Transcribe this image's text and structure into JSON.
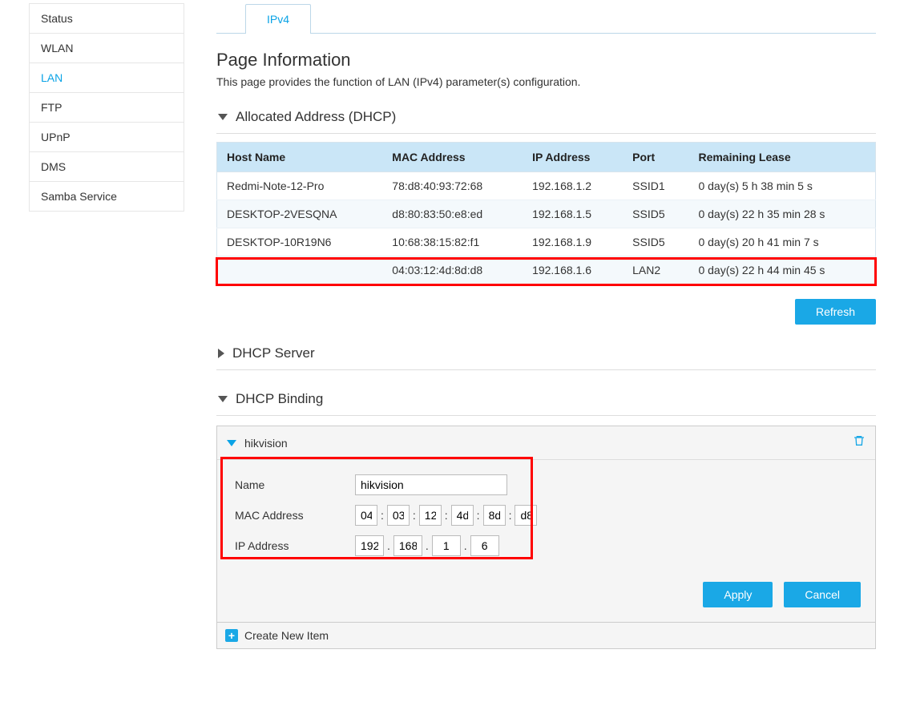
{
  "sidebar": {
    "items": [
      {
        "label": "Status"
      },
      {
        "label": "WLAN"
      },
      {
        "label": "LAN"
      },
      {
        "label": "FTP"
      },
      {
        "label": "UPnP"
      },
      {
        "label": "DMS"
      },
      {
        "label": "Samba Service"
      }
    ],
    "active_index": 2
  },
  "tabs": {
    "active": "IPv4"
  },
  "page": {
    "title": "Page Information",
    "description": "This page provides the function of LAN (IPv4) parameter(s) configuration."
  },
  "sections": {
    "allocated": {
      "title": "Allocated Address (DHCP)",
      "columns": [
        "Host Name",
        "MAC Address",
        "IP Address",
        "Port",
        "Remaining Lease"
      ],
      "rows": [
        {
          "host": "Redmi-Note-12-Pro",
          "mac": "78:d8:40:93:72:68",
          "ip": "192.168.1.2",
          "port": "SSID1",
          "lease": "0 day(s) 5 h 38 min 5 s"
        },
        {
          "host": "DESKTOP-2VESQNA",
          "mac": "d8:80:83:50:e8:ed",
          "ip": "192.168.1.5",
          "port": "SSID5",
          "lease": "0 day(s) 22 h 35 min 28 s"
        },
        {
          "host": "DESKTOP-10R19N6",
          "mac": "10:68:38:15:82:f1",
          "ip": "192.168.1.9",
          "port": "SSID5",
          "lease": "0 day(s) 20 h 41 min 7 s"
        },
        {
          "host": "",
          "mac": "04:03:12:4d:8d:d8",
          "ip": "192.168.1.6",
          "port": "LAN2",
          "lease": "0 day(s) 22 h 44 min 45 s"
        }
      ],
      "refresh_label": "Refresh"
    },
    "dhcp_server": {
      "title": "DHCP Server"
    },
    "binding": {
      "title": "DHCP Binding",
      "item_title": "hikvision",
      "form": {
        "name_label": "Name",
        "name_value": "hikvision",
        "mac_label": "MAC Address",
        "mac": [
          "04",
          "03",
          "12",
          "4d",
          "8d",
          "d8"
        ],
        "ip_label": "IP Address",
        "ip": [
          "192",
          "168",
          "1",
          "6"
        ]
      },
      "apply_label": "Apply",
      "cancel_label": "Cancel",
      "create_label": "Create New Item"
    }
  }
}
